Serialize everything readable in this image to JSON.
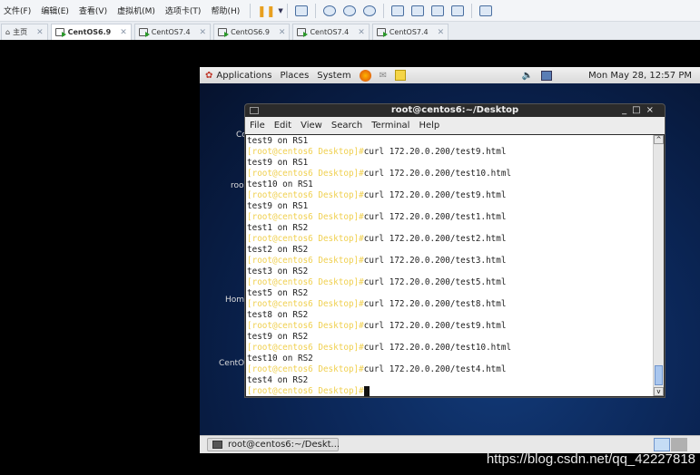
{
  "host": {
    "menus": [
      "文件(F)",
      "编辑(E)",
      "查看(V)",
      "虚拟机(M)",
      "选项卡(T)",
      "帮助(H)"
    ],
    "tabs": [
      {
        "label": "主页",
        "icon": "home-icon"
      },
      {
        "label": "CentOS6.9",
        "active": true
      },
      {
        "label": "CentOS7.4"
      },
      {
        "label": "CentOS6.9"
      },
      {
        "label": "CentOS7.4"
      },
      {
        "label": "CentOS7.4"
      }
    ]
  },
  "panel": {
    "items": [
      "Applications",
      "Places",
      "System"
    ],
    "clock": "Mon May 28, 12:57 PM"
  },
  "desktop": {
    "icons": [
      "Co",
      "roo",
      "Hom",
      "CentO"
    ]
  },
  "terminal": {
    "title": "root@centos6:~/Desktop",
    "menus": [
      "File",
      "Edit",
      "View",
      "Search",
      "Terminal",
      "Help"
    ],
    "prompt": "[root@centos6 Desktop]#",
    "lines": [
      {
        "out": "test9 on RS1"
      },
      {
        "cmd": "curl 172.20.0.200/test9.html"
      },
      {
        "out": "test9 on RS1"
      },
      {
        "cmd": "curl 172.20.0.200/test10.html"
      },
      {
        "out": "test10 on RS1"
      },
      {
        "cmd": "curl 172.20.0.200/test9.html"
      },
      {
        "out": "test9 on RS1"
      },
      {
        "cmd": "curl 172.20.0.200/test1.html"
      },
      {
        "out": "test1 on RS2"
      },
      {
        "cmd": "curl 172.20.0.200/test2.html"
      },
      {
        "out": "test2 on RS2"
      },
      {
        "cmd": "curl 172.20.0.200/test3.html"
      },
      {
        "out": "test3 on RS2"
      },
      {
        "cmd": "curl 172.20.0.200/test5.html"
      },
      {
        "out": "test5 on RS2"
      },
      {
        "cmd": "curl 172.20.0.200/test8.html"
      },
      {
        "out": "test8 on RS2"
      },
      {
        "cmd": "curl 172.20.0.200/test9.html"
      },
      {
        "out": "test9 on RS2"
      },
      {
        "cmd": "curl 172.20.0.200/test10.html"
      },
      {
        "out": "test10 on RS2"
      },
      {
        "cmd": "curl 172.20.0.200/test4.html"
      },
      {
        "out": "test4 on RS2"
      },
      {
        "cmd": ""
      }
    ]
  },
  "taskbar": {
    "window": "root@centos6:~/Deskt..."
  },
  "watermark": "https://blog.csdn.net/qq_42227818"
}
